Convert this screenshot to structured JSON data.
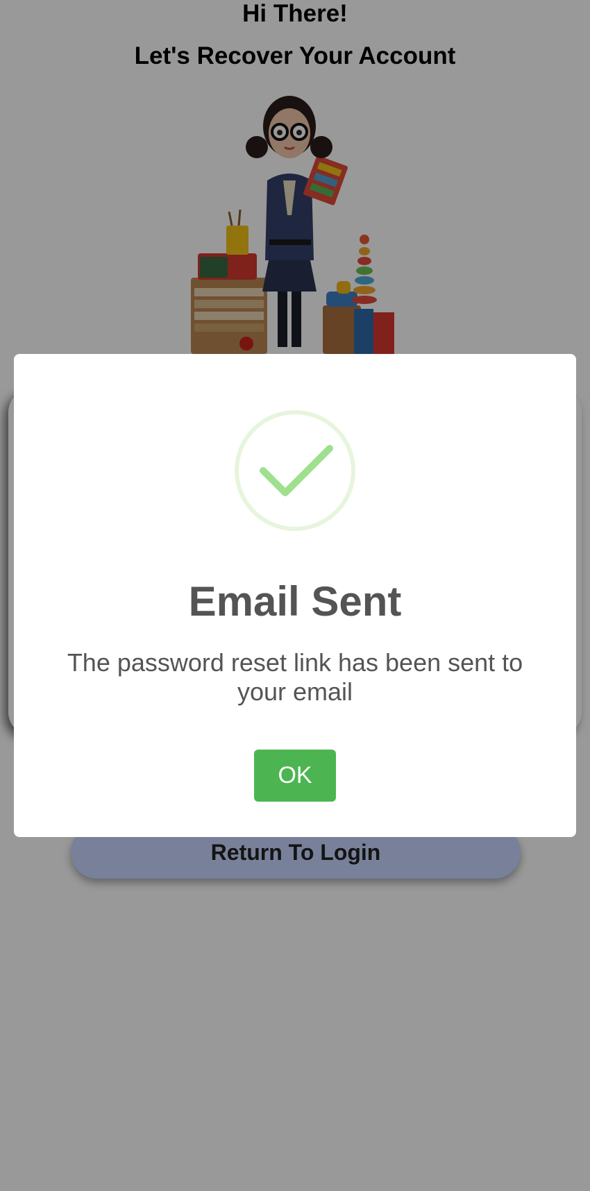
{
  "page": {
    "greeting": "Hi There!",
    "subtitle": "Let's Recover Your Account",
    "illustration": "teacher-illustration",
    "return_button_label": "Return To Login"
  },
  "modal": {
    "icon": "success-check-icon",
    "title": "Email Sent",
    "message": "The password reset link has been sent to your email",
    "ok_label": "OK"
  },
  "colors": {
    "overlay": "#000000",
    "ok_button": "#4cb551",
    "check_stroke": "#9ee08e",
    "check_ring": "#e6f5dc",
    "text": "#545454"
  }
}
